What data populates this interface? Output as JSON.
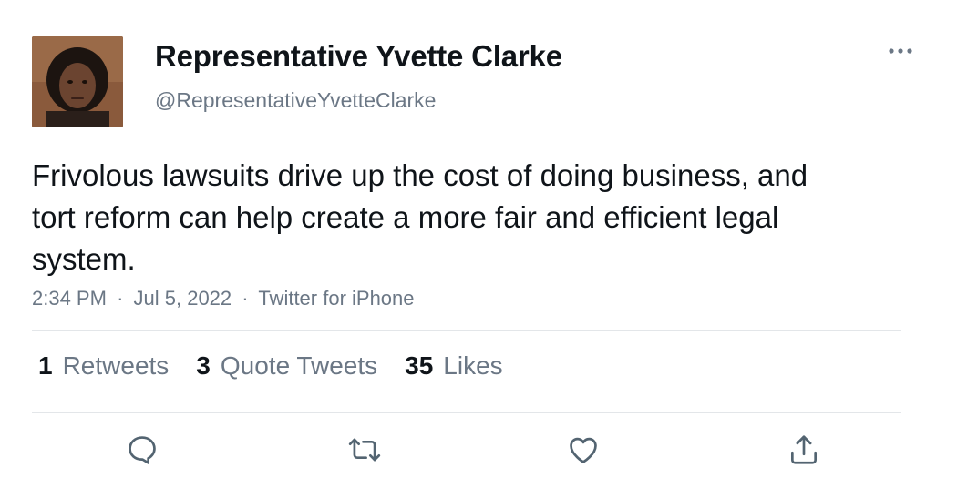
{
  "tweet": {
    "display_name": "Representative Yvette Clarke",
    "handle": "@RepresentativeYvetteClarke",
    "text": "Frivolous lawsuits drive up the cost of doing business, and tort reform can help create a more fair and efficient legal system.",
    "time": "2:34 PM",
    "date": "Jul 5, 2022",
    "source": "Twitter for iPhone",
    "separator": "·"
  },
  "stats": [
    {
      "count": "1",
      "label": "Retweets"
    },
    {
      "count": "3",
      "label": "Quote Tweets"
    },
    {
      "count": "35",
      "label": "Likes"
    }
  ],
  "actions": {
    "reply_icon": "reply-icon",
    "retweet_icon": "retweet-icon",
    "like_icon": "heart-icon",
    "share_icon": "share-icon"
  },
  "colors": {
    "text": "#0f1419",
    "secondary": "#6b7785",
    "divider": "#e3e6e9",
    "icon": "#536471"
  }
}
